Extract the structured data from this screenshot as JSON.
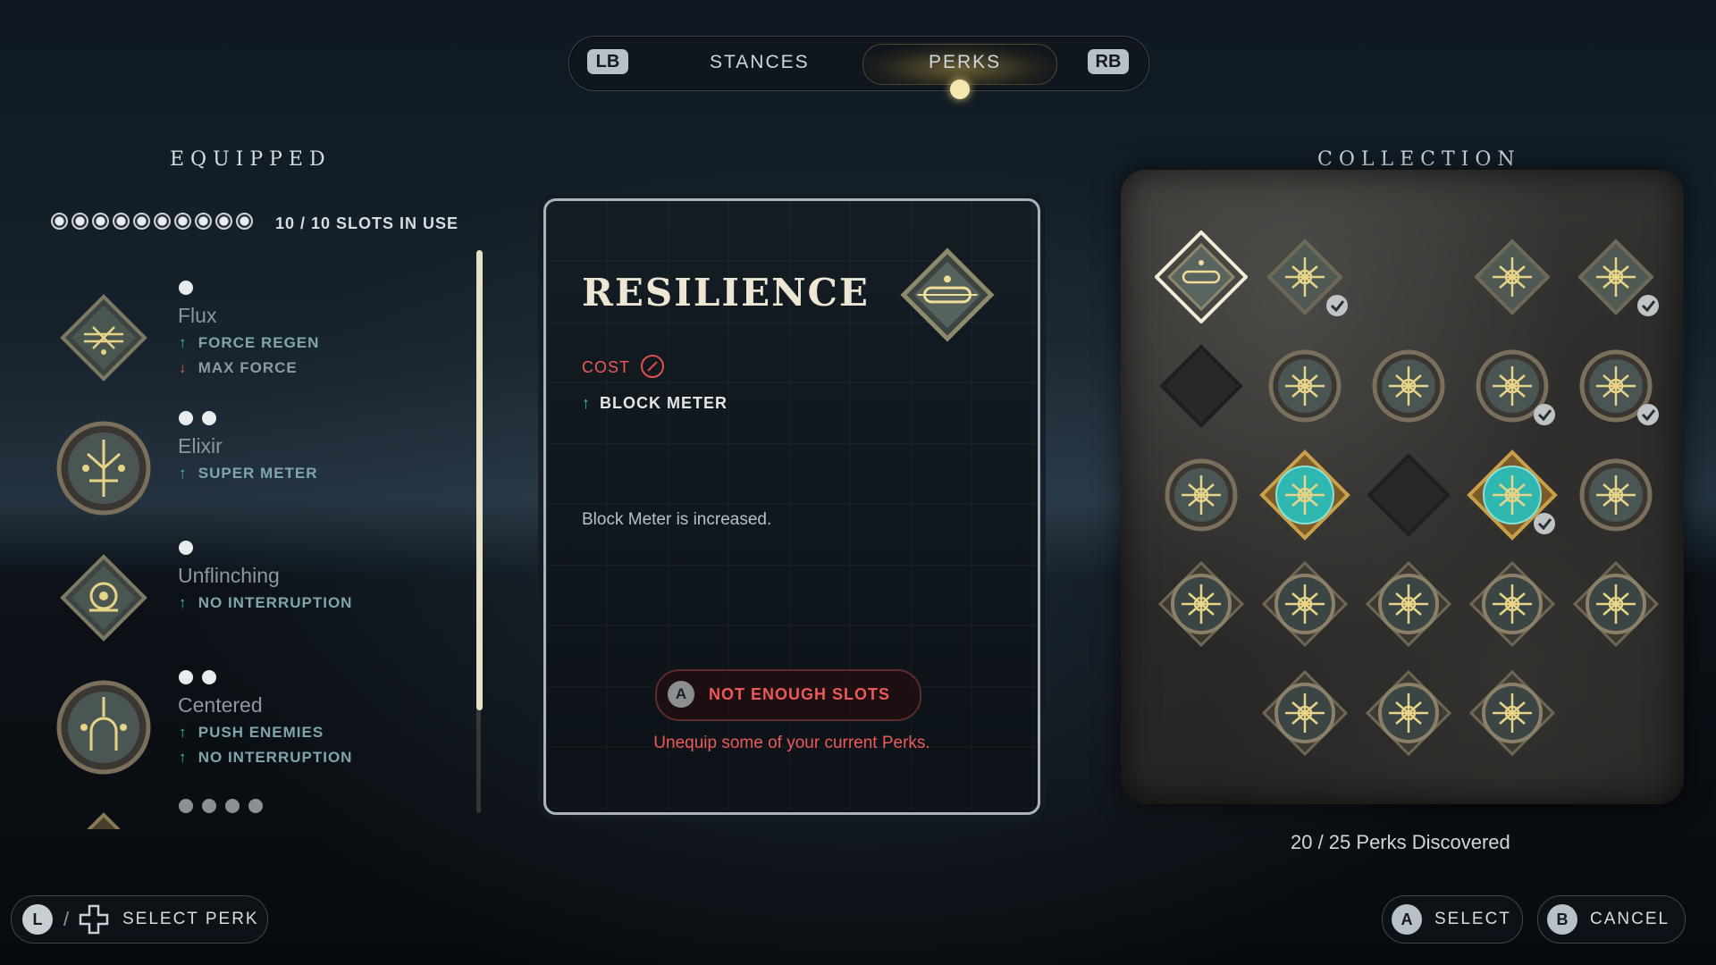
{
  "tabs": {
    "lb": "LB",
    "rb": "RB",
    "items": [
      {
        "label": "STANCES",
        "active": false
      },
      {
        "label": "PERKS",
        "active": true
      }
    ]
  },
  "equipped": {
    "title": "EQUIPPED",
    "slots_in_use": 10,
    "slots_total": 10,
    "slots_text": "10 / 10 SLOTS IN USE",
    "perks": [
      {
        "name": "Flux",
        "cost": 1,
        "icon": "diamond-rune-icon",
        "stats": [
          {
            "dir": "up",
            "text": "FORCE REGEN"
          },
          {
            "dir": "down",
            "text": "MAX FORCE"
          }
        ]
      },
      {
        "name": "Elixir",
        "cost": 2,
        "icon": "round-rune-icon",
        "stats": [
          {
            "dir": "up",
            "text": "SUPER METER"
          }
        ]
      },
      {
        "name": "Unflinching",
        "cost": 1,
        "icon": "diamond-rune-icon",
        "stats": [
          {
            "dir": "up",
            "text": "NO INTERRUPTION"
          }
        ]
      },
      {
        "name": "Centered",
        "cost": 2,
        "icon": "round-rune-icon",
        "stats": [
          {
            "dir": "up",
            "text": "PUSH ENEMIES"
          },
          {
            "dir": "up",
            "text": "NO INTERRUPTION"
          }
        ]
      },
      {
        "name": "",
        "cost": 4,
        "icon": "diamond-rune-icon",
        "stats": []
      }
    ]
  },
  "detail": {
    "title": "RESILIENCE",
    "cost_label": "COST",
    "stat": "BLOCK METER",
    "description": "Block Meter is increased.",
    "action_button": "A",
    "action_label": "NOT ENOUGH SLOTS",
    "warning": "Unequip some of your current Perks."
  },
  "collection": {
    "title": "COLLECTION",
    "discovered_text": "20 / 25 Perks Discovered",
    "grid": [
      [
        "selected-diamond",
        "diamond-check",
        "empty",
        "diamond",
        "diamond-check"
      ],
      [
        "empty-diamond",
        "round",
        "round",
        "round-check",
        "round-check"
      ],
      [
        "round",
        "teal-diamond",
        "empty-diamond",
        "teal-diamond-check",
        "round"
      ],
      [
        "diamond-round",
        "diamond-round",
        "diamond-round",
        "diamond-round",
        "diamond-round"
      ],
      [
        "empty",
        "diamond-round",
        "diamond-round",
        "diamond-round",
        "empty"
      ]
    ]
  },
  "prompts": {
    "select_perk_button": "L",
    "select_perk": "SELECT PERK",
    "select_button": "A",
    "select": "SELECT",
    "cancel_button": "B",
    "cancel": "CANCEL"
  },
  "colors": {
    "accent_gold": "#f5e6b0",
    "warning_red": "#ee5a58",
    "stat_up": "#3fbfb0",
    "stat_down": "#e0575a"
  }
}
